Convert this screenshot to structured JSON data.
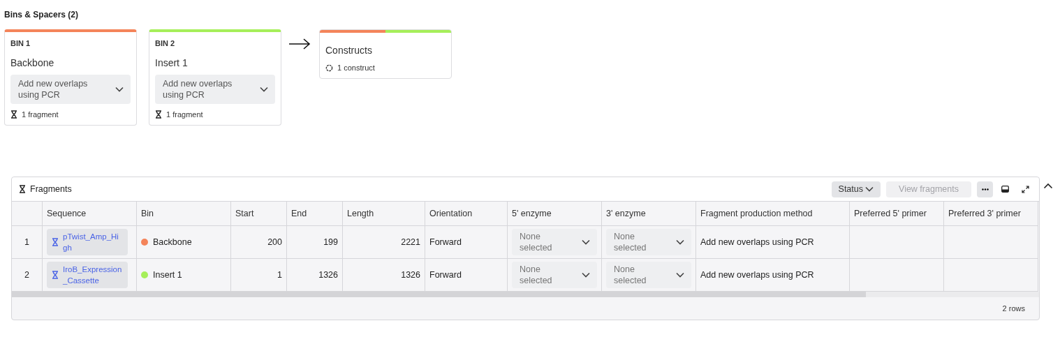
{
  "section_title": "Bins & Spacers (2)",
  "bins": [
    {
      "label": "BIN 1",
      "name": "Backbone",
      "method": "Add new overlaps using PCR",
      "fragments": "1 fragment",
      "color": "#f4845a"
    },
    {
      "label": "BIN 2",
      "name": "Insert 1",
      "method": "Add new overlaps using PCR",
      "fragments": "1 fragment",
      "color": "#a6ef5a"
    }
  ],
  "constructs": {
    "title": "Constructs",
    "count": "1 construct"
  },
  "fragments_panel": {
    "title": "Fragments",
    "buttons": [
      {
        "kind": "dropdown",
        "label": "Status",
        "disabled": false
      },
      {
        "kind": "plain",
        "label": "View fragments",
        "disabled": true
      }
    ],
    "columns": [
      "Sequence",
      "Bin",
      "Start",
      "End",
      "Length",
      "Orientation",
      "5' enzyme",
      "3' enzyme",
      "Fragment production method",
      "Preferred 5' primer",
      "Preferred 3' primer"
    ],
    "rows": [
      {
        "index": "1",
        "sequence": "pTwist_Amp_High",
        "bin": "Backbone",
        "color": "#f4845a",
        "start": "200",
        "end": "199",
        "length": "2221",
        "orientation": "Forward",
        "enzyme_5": "None selected",
        "enzyme_3": "None selected",
        "method": "Add new overlaps using PCR"
      },
      {
        "index": "2",
        "sequence": "IroB_Expression_Cassette",
        "bin": "Insert 1",
        "color": "#a6ef5a",
        "start": "1",
        "end": "1326",
        "length": "1326",
        "orientation": "Forward",
        "enzyme_5": "None selected",
        "enzyme_3": "None selected",
        "method": "Add new overlaps using PCR"
      }
    ],
    "footer": "2 rows"
  }
}
